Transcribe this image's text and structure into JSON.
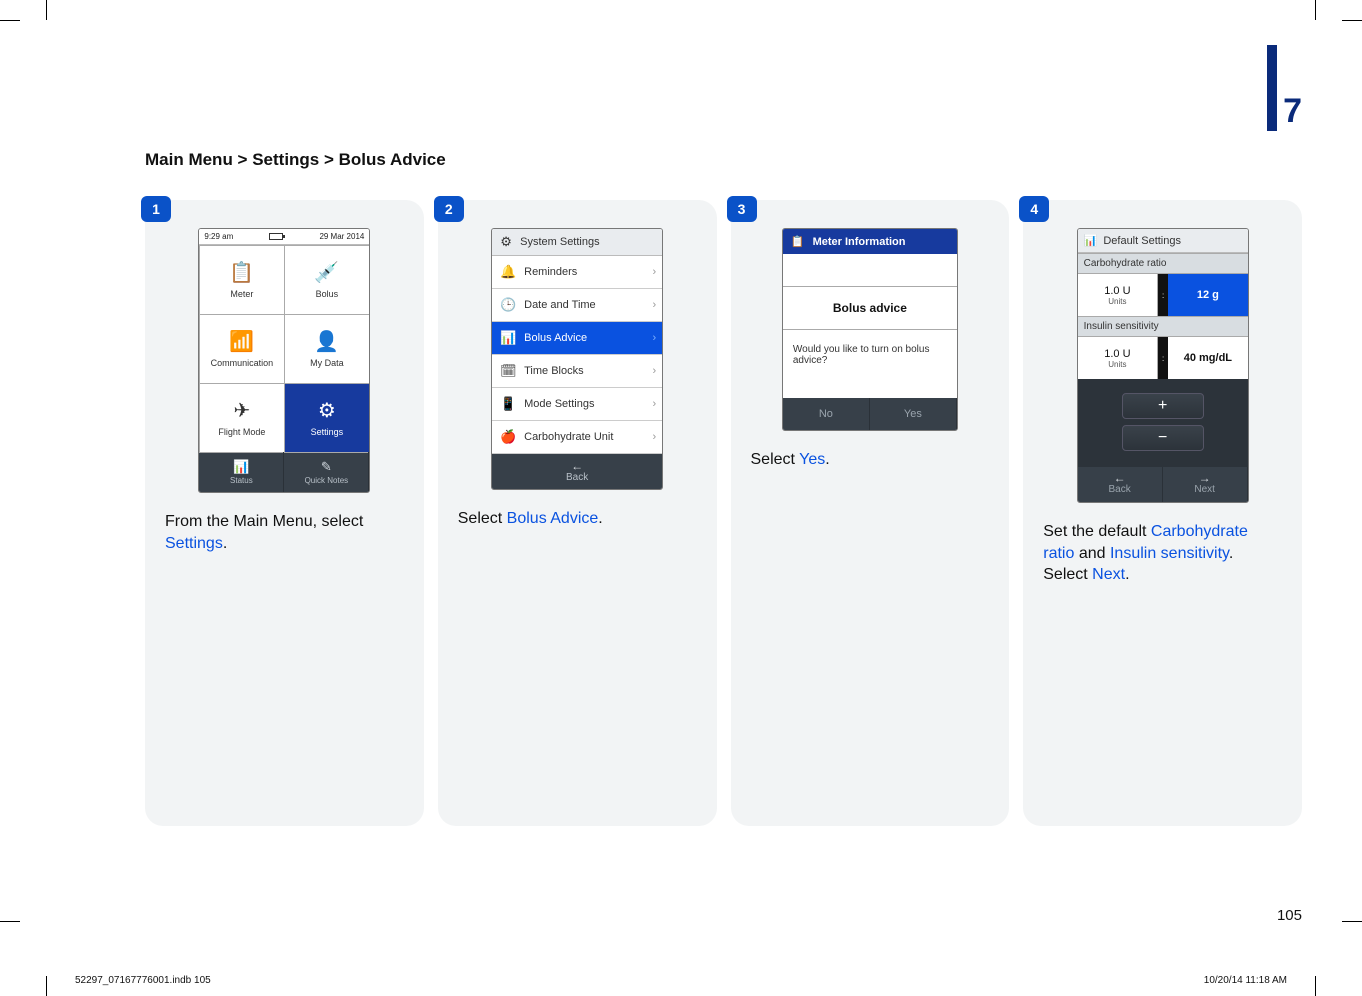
{
  "chapter_number": "7",
  "breadcrumb": "Main Menu > Settings > Bolus Advice",
  "page_number": "105",
  "footer_left": "52297_07167776001.indb   105",
  "footer_right": "10/20/14   11:18 AM",
  "steps": [
    {
      "badge": "1",
      "screen": {
        "time": "9:29 am",
        "date": "29 Mar 2014",
        "tiles": [
          {
            "label": "Meter",
            "icon": "📋"
          },
          {
            "label": "Bolus",
            "icon": "💉"
          },
          {
            "label": "Communication",
            "icon": "📶"
          },
          {
            "label": "My Data",
            "icon": "👤"
          },
          {
            "label": "Flight Mode",
            "icon": "✈"
          },
          {
            "label": "Settings",
            "icon": "⚙",
            "selected": true
          }
        ],
        "footer": [
          {
            "label": "Status",
            "icon": "📊"
          },
          {
            "label": "Quick Notes",
            "icon": "✎"
          }
        ]
      },
      "caption_pre": "From the Main Menu, select ",
      "caption_hl": "Settings",
      "caption_post": "."
    },
    {
      "badge": "2",
      "screen": {
        "title": "System Settings",
        "title_icon": "⚙",
        "rows": [
          {
            "label": "Reminders",
            "icon": "🔔"
          },
          {
            "label": "Date and Time",
            "icon": "🕒"
          },
          {
            "label": "Bolus Advice",
            "icon": "📊",
            "selected": true
          },
          {
            "label": "Time Blocks",
            "icon": "🗓"
          },
          {
            "label": "Mode Settings",
            "icon": "📱"
          },
          {
            "label": "Carbohydrate Unit",
            "icon": "🍎"
          }
        ],
        "back": "Back"
      },
      "caption_pre": "Select ",
      "caption_hl": "Bolus Advice",
      "caption_post": "."
    },
    {
      "badge": "3",
      "screen": {
        "title": "Meter Information",
        "heading": "Bolus advice",
        "question": "Would you like to turn on bolus advice?",
        "no": "No",
        "yes": "Yes"
      },
      "caption_pre": "Select ",
      "caption_hl": "Yes",
      "caption_post": "."
    },
    {
      "badge": "4",
      "screen": {
        "title": "Default Settings",
        "title_icon": "📊",
        "section1": "Carbohydrate ratio",
        "carb_val": "1.0 U",
        "carb_unit": "Units",
        "carb_right": "12 g",
        "section2": "Insulin sensitivity",
        "ins_val": "1.0 U",
        "ins_unit": "Units",
        "ins_right": "40 mg/dL",
        "plus": "+",
        "minus": "−",
        "back": "Back",
        "next": "Next"
      },
      "caption_parts": {
        "a": "Set the default ",
        "b": "Carbohydrate ratio",
        "c": " and ",
        "d": "Insulin sensitivity",
        "e": ". Select ",
        "f": "Next",
        "g": "."
      }
    }
  ]
}
